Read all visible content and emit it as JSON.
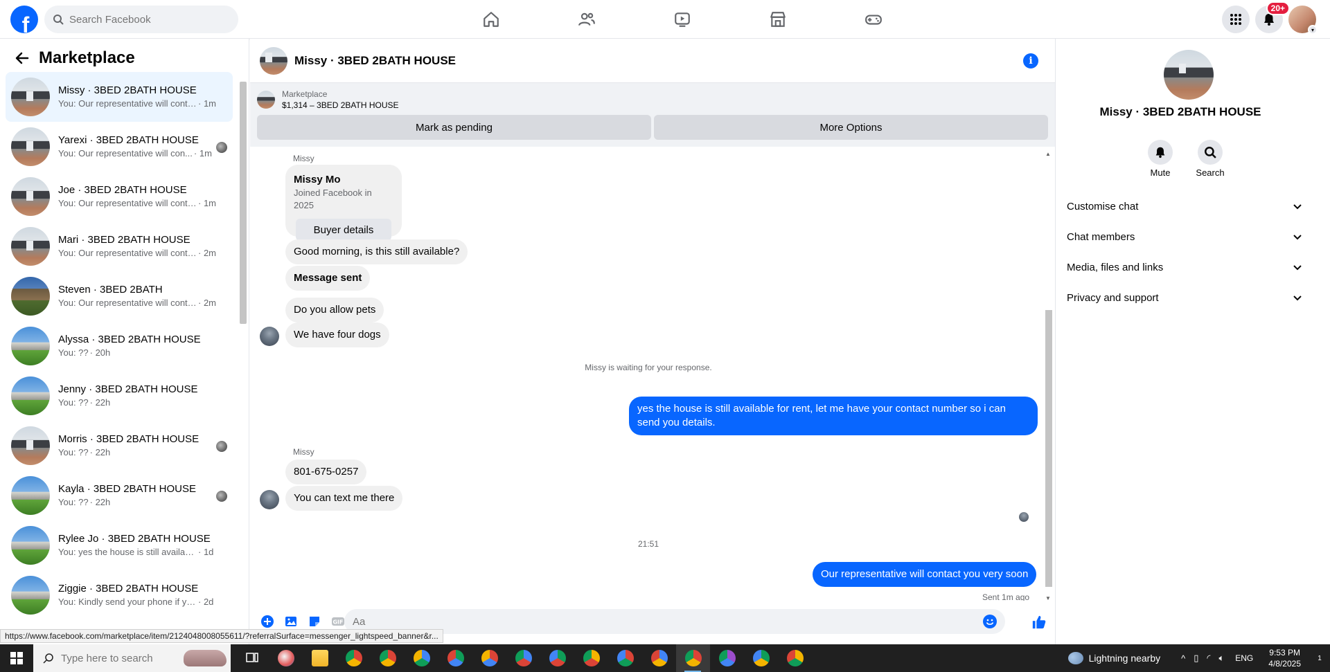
{
  "topbar": {
    "search_placeholder": "Search Facebook",
    "notification_badge": "20+",
    "brand_color": "#0866ff"
  },
  "left": {
    "title": "Marketplace",
    "conversations": [
      {
        "name": "Missy · 3BED 2BATH HOUSE",
        "preview": "You: Our representative will conta...",
        "time": "· 1m",
        "thumb": "house",
        "seen": false,
        "active": true
      },
      {
        "name": "Yarexi · 3BED 2BATH HOUSE",
        "preview": "You: Our representative will con...",
        "time": "· 1m",
        "thumb": "house",
        "seen": true,
        "active": false
      },
      {
        "name": "Joe · 3BED 2BATH HOUSE",
        "preview": "You: Our representative will conta...",
        "time": "· 1m",
        "thumb": "house",
        "seen": false,
        "active": false
      },
      {
        "name": "Mari · 3BED 2BATH HOUSE",
        "preview": "You: Our representative will conta...",
        "time": "· 2m",
        "thumb": "house",
        "seen": false,
        "active": false
      },
      {
        "name": "Steven · 3BED 2BATH",
        "preview": "You: Our representative will conta...",
        "time": "· 2m",
        "thumb": "brown",
        "seen": false,
        "active": false
      },
      {
        "name": "Alyssa · 3BED 2BATH HOUSE",
        "preview": "You: ??",
        "time": "· 20h",
        "thumb": "grass",
        "seen": false,
        "active": false
      },
      {
        "name": "Jenny · 3BED 2BATH HOUSE",
        "preview": "You: ??",
        "time": "· 22h",
        "thumb": "grass",
        "seen": false,
        "active": false
      },
      {
        "name": "Morris · 3BED 2BATH HOUSE",
        "preview": "You: ??",
        "time": "· 22h",
        "thumb": "house",
        "seen": true,
        "active": false
      },
      {
        "name": "Kayla · 3BED 2BATH HOUSE",
        "preview": "You: ??",
        "time": "· 22h",
        "thumb": "grass",
        "seen": true,
        "active": false
      },
      {
        "name": "Rylee Jo · 3BED 2BATH HOUSE",
        "preview": "You: yes the house is still available ...",
        "time": "· 1d",
        "thumb": "grass",
        "seen": false,
        "active": false
      },
      {
        "name": "Ziggie · 3BED 2BATH HOUSE",
        "preview": "You: Kindly send your phone if you...",
        "time": "· 2d",
        "thumb": "grass",
        "seen": false,
        "active": false
      }
    ]
  },
  "chat": {
    "title": "Missy · 3BED 2BATH HOUSE",
    "marketplace_label": "Marketplace",
    "listing": "$1,314 – 3BED 2BATH HOUSE",
    "mark_pending": "Mark as pending",
    "more_options": "More Options",
    "sender1": "Missy",
    "profile_name": "Missy Mo",
    "profile_joined": "Joined Facebook in 2025",
    "buyer_details": "Buyer details",
    "msg1": "Good morning, is this still available?",
    "msg2": "Message sent",
    "msg3": "Do you allow pets",
    "msg4": "We have four dogs",
    "waiting": "Missy is waiting for your response.",
    "reply1": "yes the house is still available for rent, let me have your contact number so i can send you details.",
    "sender2": "Missy",
    "msg5": "801-675-0257",
    "msg6": "You can text me there",
    "timestamp": "21:51",
    "reply2": "Our representative will contact you very soon",
    "sent_status": "Sent 1m ago",
    "composer_placeholder": "Aa"
  },
  "right": {
    "title": "Missy · 3BED 2BATH HOUSE",
    "mute": "Mute",
    "search": "Search",
    "sections": [
      "Customise chat",
      "Chat members",
      "Media, files and links",
      "Privacy and support"
    ]
  },
  "status_url": "https://www.facebook.com/marketplace/item/2124048008055611/?referralSurface=messenger_lightspeed_banner&r...",
  "taskbar": {
    "search_placeholder": "Type here to search",
    "weather": "Lightning nearby",
    "lang": "ENG",
    "time": "9:53 PM",
    "date": "4/8/2025",
    "notif_count": "1"
  }
}
